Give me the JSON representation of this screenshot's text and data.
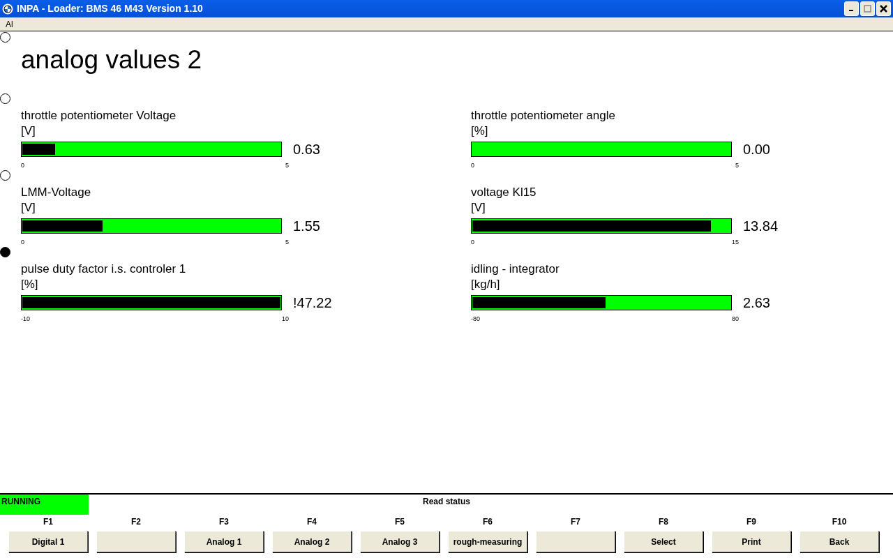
{
  "window": {
    "title": "INPA - Loader:  BMS 46 M43 Version 1.10"
  },
  "menu": [
    "Al"
  ],
  "markers": [
    {
      "selected": false
    },
    {
      "selected": false
    },
    {
      "selected": false
    },
    {
      "selected": true
    }
  ],
  "heading": "analog values 2",
  "gauges": [
    {
      "name": "throttle potentiometer Voltage",
      "unit": "[V]",
      "level": 0.126,
      "min": "0",
      "max": "5",
      "reading": "0.63"
    },
    {
      "name": "throttle potentiometer angle",
      "unit": "[%]",
      "level": 0,
      "min": "0",
      "max": "5",
      "reading": "0.00"
    },
    {
      "name": "LMM-Voltage",
      "unit": "[V]",
      "level": 0.31,
      "min": "0",
      "max": "5",
      "reading": "1.55"
    },
    {
      "name": "voltage Kl15",
      "unit": "[V]",
      "level": 0.923,
      "min": "0",
      "max": "15",
      "reading": "13.84"
    },
    {
      "name": "pulse duty factor i.s. controler 1",
      "unit": "[%]",
      "level": 1,
      "min": "-10",
      "max": "10",
      "reading": "!47.22"
    },
    {
      "name": "idling - integrator",
      "unit": "[kg/h]",
      "level": 0.516,
      "min": "-80",
      "max": "80",
      "reading": "2.63"
    }
  ],
  "status_bar": {
    "state": "RUNNING",
    "message": "Read status"
  },
  "function_keys": [
    {
      "key": "F1",
      "label": "Digital 1"
    },
    {
      "key": "F2"
    },
    {
      "key": "F3",
      "label": "Analog 1"
    },
    {
      "key": "F4",
      "label": "Analog 2"
    },
    {
      "key": "F5",
      "label": "Analog 3"
    },
    {
      "key": "F6",
      "label": "rough-measuring"
    },
    {
      "key": "F7"
    },
    {
      "key": "F8",
      "label": "Select"
    },
    {
      "key": "F9",
      "label": "Print"
    },
    {
      "key": "F10",
      "label": "Back"
    }
  ]
}
